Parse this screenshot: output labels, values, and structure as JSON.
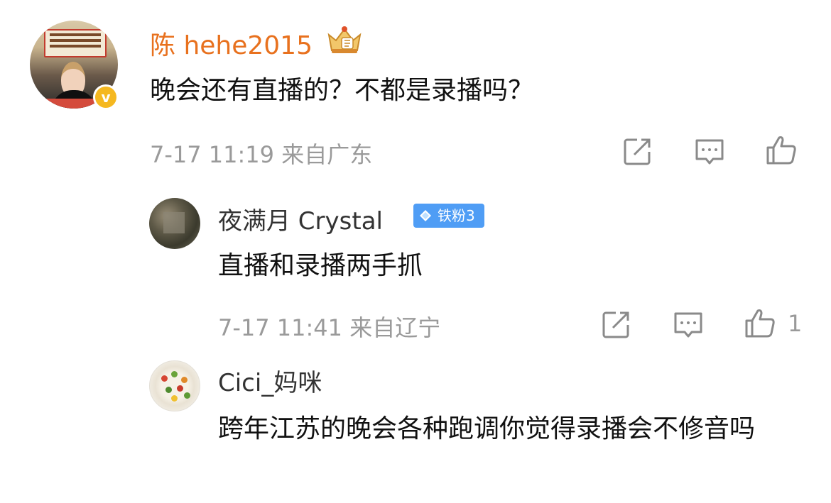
{
  "comment": {
    "author": "陈 hehe2015",
    "text": "晚会还有直播的？不都是录播吗？",
    "time": "7-17 11:19",
    "location": "来自广东",
    "verified_icon": "v-badge",
    "vip_icon": "crown-badge"
  },
  "replies": [
    {
      "author": "夜满月 Crystal",
      "badge": "铁粉3",
      "text": "直播和录播两手抓",
      "time": "7-17 11:41",
      "location": "来自辽宁",
      "like_count": "1"
    },
    {
      "author": "Cici_妈咪",
      "text": "跨年江苏的晚会各种跑调你觉得录播会不修音吗"
    }
  ],
  "actions": {
    "repost_icon": "repost-icon",
    "comment_icon": "comment-icon",
    "like_icon": "like-icon"
  },
  "colors": {
    "name_accent": "#e8711e",
    "badge_blue": "#4f9df5",
    "verified_gold": "#f5b820",
    "meta_gray": "#9a9a9a"
  }
}
